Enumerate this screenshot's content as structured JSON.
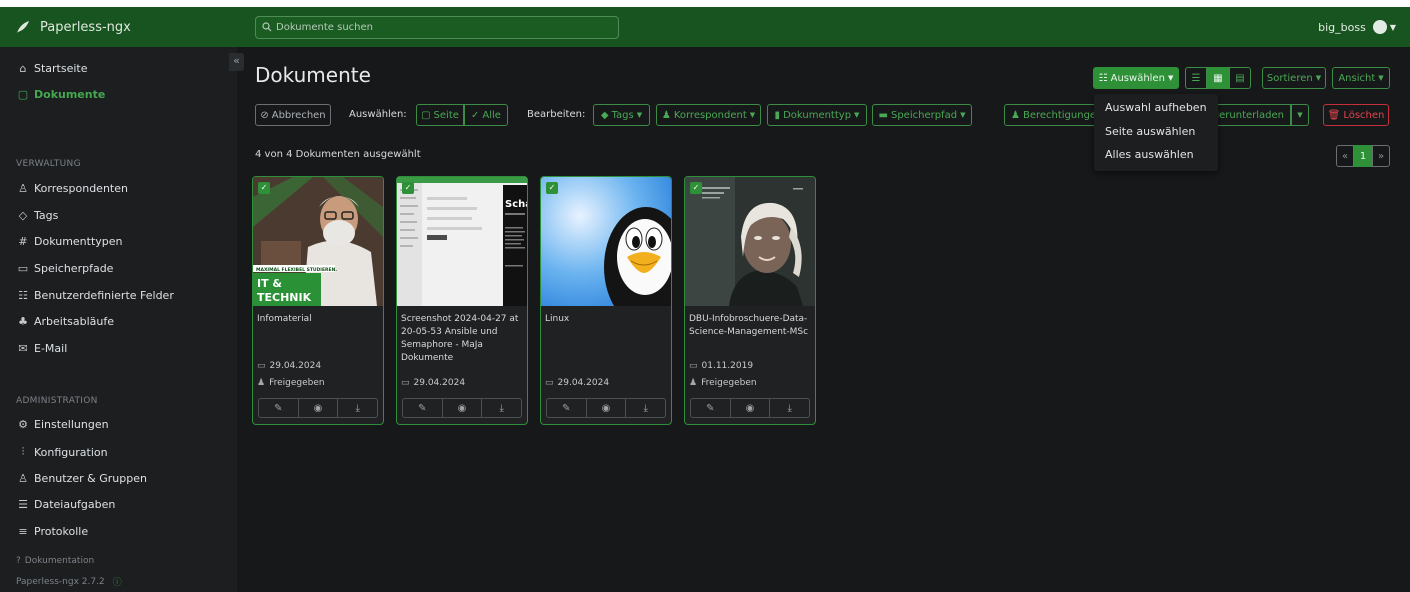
{
  "app": {
    "name": "Paperless-ngx"
  },
  "search": {
    "placeholder": "Dokumente suchen"
  },
  "user": {
    "name": "big_boss"
  },
  "sidebar": {
    "top_items": [
      {
        "label": "Startseite",
        "icon": "home-icon"
      },
      {
        "label": "Dokumente",
        "icon": "documents-icon",
        "active": true
      }
    ],
    "section_verwaltung": "VERWALTUNG",
    "verwaltung_items": [
      {
        "label": "Korrespondenten",
        "icon": "person-icon"
      },
      {
        "label": "Tags",
        "icon": "tags-icon"
      },
      {
        "label": "Dokumenttypen",
        "icon": "hash-icon"
      },
      {
        "label": "Speicherpfade",
        "icon": "folder-icon"
      },
      {
        "label": "Benutzerdefinierte Felder",
        "icon": "fields-icon"
      },
      {
        "label": "Arbeitsabläufe",
        "icon": "workflow-icon"
      },
      {
        "label": "E-Mail",
        "icon": "mail-icon"
      }
    ],
    "section_admin": "ADMINISTRATION",
    "admin_items": [
      {
        "label": "Einstellungen",
        "icon": "gear-icon"
      },
      {
        "label": "Konfiguration",
        "icon": "sliders-icon"
      },
      {
        "label": "Benutzer & Gruppen",
        "icon": "users-icon"
      },
      {
        "label": "Dateiaufgaben",
        "icon": "list-icon"
      },
      {
        "label": "Protokolle",
        "icon": "logs-icon"
      }
    ],
    "docs_link": "Dokumentation",
    "version": "Paperless-ngx 2.7.2"
  },
  "page": {
    "title": "Dokumente",
    "selection_info": "4 von 4 Dokumenten ausgewählt"
  },
  "toolbar": {
    "select_label": "Auswählen",
    "sort_label": "Sortieren",
    "view_label": "Ansicht",
    "cancel_label": "Abbrechen",
    "select_prefix": "Auswählen:",
    "select_page": "Seite",
    "select_all": "Alle",
    "edit_prefix": "Bearbeiten:",
    "tags": "Tags",
    "correspondent": "Korrespondent",
    "doctype": "Dokumenttyp",
    "storage_path": "Speicherpfad",
    "permissions": "Berechtigunge",
    "download": "Herunterladen",
    "delete": "Löschen"
  },
  "select_menu": [
    "Auswahl aufheben",
    "Seite auswählen",
    "Alles auswählen"
  ],
  "pagination": {
    "prev": "«",
    "current": "1",
    "next": "»"
  },
  "documents": [
    {
      "title": "Infomaterial",
      "date": "29.04.2024",
      "shared": "Freigegeben",
      "thumb_banner": "MAXIMAL FLEXIBEL STUDIEREN.",
      "thumb_text1": "IT &",
      "thumb_text2": "TECHNIK"
    },
    {
      "title": "Screenshot 2024-04-27 at 20-05-53 Ansible und Semaphore - MaJa Dokumente",
      "date": "29.04.2024",
      "thumb_text": "Scha"
    },
    {
      "title": "Linux",
      "date": "29.04.2024"
    },
    {
      "title": "DBU-Infobroschuere-Data-Science-Management-MSc",
      "date": "01.11.2019",
      "shared": "Freigegeben"
    }
  ],
  "colors": {
    "topbar": "#17541f",
    "accent": "#2e9138",
    "danger": "#c3303b",
    "bg": "#161819"
  }
}
